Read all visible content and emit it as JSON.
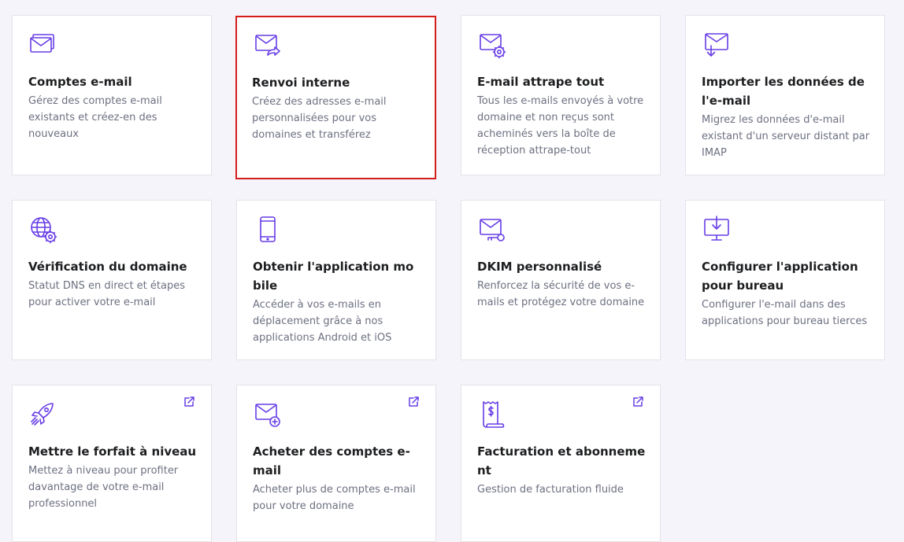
{
  "colors": {
    "background": "#f4f4fa",
    "card": "#ffffff",
    "icon": "#673de6",
    "title": "#1d1e20",
    "description": "#6d7081",
    "selected_border": "#d41d1d"
  },
  "cards": [
    {
      "title": "Comptes e-mail",
      "description": "Gérez des comptes e-mail existants et créez-en des nouveaux",
      "icon": "mailbox-stack-icon",
      "external": false,
      "selected": false
    },
    {
      "title": "Renvoi interne",
      "description": "Créez des adresses e-mail personnalisées pour vos domaines et transférez",
      "icon": "mail-forward-icon",
      "external": false,
      "selected": true
    },
    {
      "title": "E-mail attrape tout",
      "description": "Tous les e-mails envoyés à votre domaine et non reçus sont acheminés vers la boîte de réception attrape-tout",
      "icon": "mail-gear-icon",
      "external": false,
      "selected": false
    },
    {
      "title": "Importer les données de l'e-mail",
      "description": "Migrez les données d'e-mail existant d'un serveur distant par IMAP",
      "icon": "mail-import-icon",
      "external": false,
      "selected": false
    },
    {
      "title": "Vérification du domaine",
      "description": "Statut DNS en direct et étapes pour activer votre e-mail",
      "icon": "globe-gear-icon",
      "external": false,
      "selected": false
    },
    {
      "title": "Obtenir l'application mobile",
      "description": "Accéder à vos e-mails en déplacement grâce à nos applications Android et iOS",
      "icon": "smartphone-icon",
      "external": false,
      "selected": false
    },
    {
      "title": "DKIM personnalisé",
      "description": "Renforcez la sécurité de vos e-mails et protégez votre domaine",
      "icon": "mail-key-icon",
      "external": false,
      "selected": false
    },
    {
      "title": "Configurer l'application pour bureau",
      "description": "Configurer l'e-mail dans des applications pour bureau tierces",
      "icon": "desktop-download-icon",
      "external": false,
      "selected": false
    },
    {
      "title": "Mettre le forfait à niveau",
      "description": "Mettez à niveau pour profiter davantage de votre e-mail professionnel",
      "icon": "rocket-icon",
      "external": true,
      "selected": false
    },
    {
      "title": "Acheter des comptes e-mail",
      "description": "Acheter plus de comptes e-mail pour votre domaine",
      "icon": "mail-add-icon",
      "external": true,
      "selected": false
    },
    {
      "title": "Facturation et abonnement",
      "description": "Gestion de facturation fluide",
      "icon": "receipt-dollar-icon",
      "external": true,
      "selected": false
    }
  ]
}
